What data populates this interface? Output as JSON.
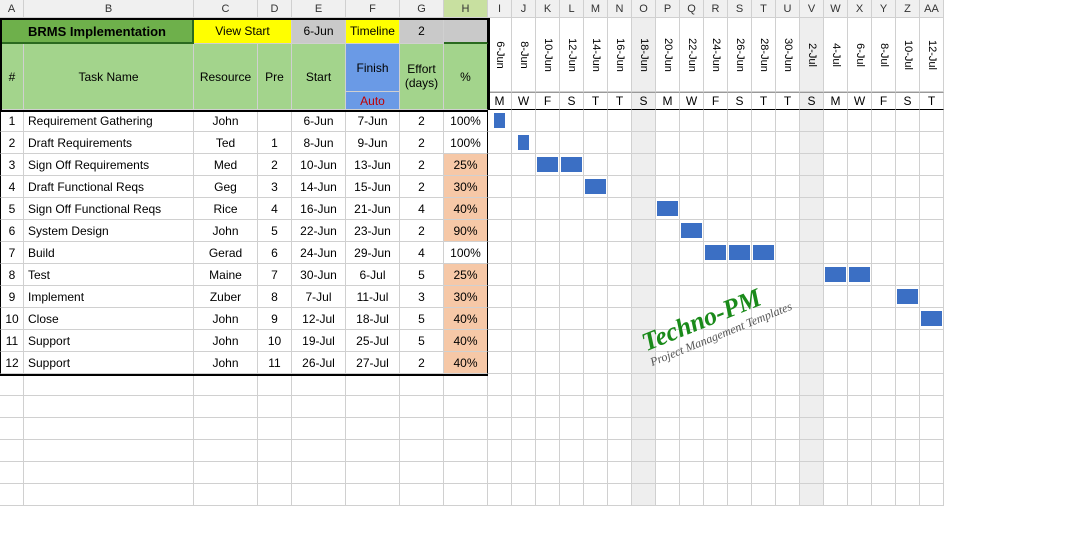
{
  "col_letters": [
    "A",
    "B",
    "C",
    "D",
    "E",
    "F",
    "G",
    "H",
    "I",
    "J",
    "K",
    "L",
    "M",
    "N",
    "O",
    "P",
    "Q",
    "R",
    "S",
    "T",
    "U",
    "V",
    "W",
    "X",
    "Y",
    "Z",
    "AA"
  ],
  "selected_col_idx": 7,
  "header": {
    "title": "BRMS Implementation",
    "view_start_label": "View Start",
    "view_start_val": "6-Jun",
    "timeline_label": "Timeline",
    "timeline_val": "2",
    "num_label": "#",
    "task_label": "Task Name",
    "resource_label": "Resource",
    "pre_label": "Pre",
    "start_label": "Start",
    "finish_label": "Finish",
    "auto_label": "Auto",
    "effort_label": "Effort (days)",
    "percent_label": "%"
  },
  "dates": [
    "6-Jun",
    "8-Jun",
    "10-Jun",
    "12-Jun",
    "14-Jun",
    "16-Jun",
    "18-Jun",
    "20-Jun",
    "22-Jun",
    "24-Jun",
    "26-Jun",
    "28-Jun",
    "30-Jun",
    "2-Jul",
    "4-Jul",
    "6-Jul",
    "8-Jul",
    "10-Jul",
    "12-Jul"
  ],
  "dows": [
    "M",
    "W",
    "F",
    "S",
    "T",
    "T",
    "S",
    "M",
    "W",
    "F",
    "S",
    "T",
    "T",
    "S",
    "M",
    "W",
    "F",
    "S",
    "T"
  ],
  "shaded_date_idx": [
    6,
    13
  ],
  "rows": [
    {
      "n": "1",
      "task": "Requirement Gathering",
      "res": "John",
      "pre": "",
      "start": "6-Jun",
      "finish": "7-Jun",
      "effort": "2",
      "pct": "100%",
      "peach": false,
      "bar_start": 0,
      "bar_len": 1,
      "partial": true
    },
    {
      "n": "2",
      "task": "Draft  Requirements",
      "res": "Ted",
      "pre": "1",
      "start": "8-Jun",
      "finish": "9-Jun",
      "effort": "2",
      "pct": "100%",
      "peach": false,
      "bar_start": 1,
      "bar_len": 1,
      "partial": true
    },
    {
      "n": "3",
      "task": "Sign Off  Requirements",
      "res": "Med",
      "pre": "2",
      "start": "10-Jun",
      "finish": "13-Jun",
      "effort": "2",
      "pct": "25%",
      "peach": true,
      "bar_start": 2,
      "bar_len": 2,
      "partial": false
    },
    {
      "n": "4",
      "task": "Draft Functional Reqs",
      "res": "Geg",
      "pre": "3",
      "start": "14-Jun",
      "finish": "15-Jun",
      "effort": "2",
      "pct": "30%",
      "peach": true,
      "bar_start": 4,
      "bar_len": 1,
      "partial": false
    },
    {
      "n": "5",
      "task": "Sign Off Functional Reqs",
      "res": "Rice",
      "pre": "4",
      "start": "16-Jun",
      "finish": "21-Jun",
      "effort": "4",
      "pct": "40%",
      "peach": true,
      "bar_start": 7,
      "bar_len": 1,
      "partial": false
    },
    {
      "n": "6",
      "task": "System Design",
      "res": "John",
      "pre": "5",
      "start": "22-Jun",
      "finish": "23-Jun",
      "effort": "2",
      "pct": "90%",
      "peach": true,
      "bar_start": 8,
      "bar_len": 1,
      "partial": false
    },
    {
      "n": "7",
      "task": "Build",
      "res": "Gerad",
      "pre": "6",
      "start": "24-Jun",
      "finish": "29-Jun",
      "effort": "4",
      "pct": "100%",
      "peach": false,
      "bar_start": 9,
      "bar_len": 3,
      "partial": false
    },
    {
      "n": "8",
      "task": "Test",
      "res": "Maine",
      "pre": "7",
      "start": "30-Jun",
      "finish": "6-Jul",
      "effort": "5",
      "pct": "25%",
      "peach": true,
      "bar_start": 14,
      "bar_len": 2,
      "partial": false
    },
    {
      "n": "9",
      "task": "Implement",
      "res": "Zuber",
      "pre": "8",
      "start": "7-Jul",
      "finish": "11-Jul",
      "effort": "3",
      "pct": "30%",
      "peach": true,
      "bar_start": 17,
      "bar_len": 1,
      "partial": false
    },
    {
      "n": "10",
      "task": "Close",
      "res": "John",
      "pre": "9",
      "start": "12-Jul",
      "finish": "18-Jul",
      "effort": "5",
      "pct": "40%",
      "peach": true,
      "bar_start": 18,
      "bar_len": 1,
      "partial": false
    },
    {
      "n": "11",
      "task": "Support",
      "res": "John",
      "pre": "10",
      "start": "19-Jul",
      "finish": "25-Jul",
      "effort": "5",
      "pct": "40%",
      "peach": true,
      "bar_start": -1,
      "bar_len": 0,
      "partial": false
    },
    {
      "n": "12",
      "task": "Support",
      "res": "John",
      "pre": "11",
      "start": "26-Jul",
      "finish": "27-Jul",
      "effort": "2",
      "pct": "40%",
      "peach": true,
      "bar_start": -1,
      "bar_len": 0,
      "partial": false
    }
  ],
  "empty_rows": 6,
  "watermark": {
    "line1": "Techno-PM",
    "line2": "Project Management Templates"
  },
  "chart_data": {
    "type": "gantt",
    "title": "BRMS Implementation",
    "timeline_step_days": 2,
    "x_dates": [
      "6-Jun",
      "8-Jun",
      "10-Jun",
      "12-Jun",
      "14-Jun",
      "16-Jun",
      "18-Jun",
      "20-Jun",
      "22-Jun",
      "24-Jun",
      "26-Jun",
      "28-Jun",
      "30-Jun",
      "2-Jul",
      "4-Jul",
      "6-Jul",
      "8-Jul",
      "10-Jul",
      "12-Jul"
    ],
    "tasks": [
      {
        "id": 1,
        "name": "Requirement Gathering",
        "resource": "John",
        "predecessor": null,
        "start": "6-Jun",
        "finish": "7-Jun",
        "effort_days": 2,
        "percent_complete": 100
      },
      {
        "id": 2,
        "name": "Draft Requirements",
        "resource": "Ted",
        "predecessor": 1,
        "start": "8-Jun",
        "finish": "9-Jun",
        "effort_days": 2,
        "percent_complete": 100
      },
      {
        "id": 3,
        "name": "Sign Off Requirements",
        "resource": "Med",
        "predecessor": 2,
        "start": "10-Jun",
        "finish": "13-Jun",
        "effort_days": 2,
        "percent_complete": 25
      },
      {
        "id": 4,
        "name": "Draft Functional Reqs",
        "resource": "Geg",
        "predecessor": 3,
        "start": "14-Jun",
        "finish": "15-Jun",
        "effort_days": 2,
        "percent_complete": 30
      },
      {
        "id": 5,
        "name": "Sign Off Functional Reqs",
        "resource": "Rice",
        "predecessor": 4,
        "start": "16-Jun",
        "finish": "21-Jun",
        "effort_days": 4,
        "percent_complete": 40
      },
      {
        "id": 6,
        "name": "System Design",
        "resource": "John",
        "predecessor": 5,
        "start": "22-Jun",
        "finish": "23-Jun",
        "effort_days": 2,
        "percent_complete": 90
      },
      {
        "id": 7,
        "name": "Build",
        "resource": "Gerad",
        "predecessor": 6,
        "start": "24-Jun",
        "finish": "29-Jun",
        "effort_days": 4,
        "percent_complete": 100
      },
      {
        "id": 8,
        "name": "Test",
        "resource": "Maine",
        "predecessor": 7,
        "start": "30-Jun",
        "finish": "6-Jul",
        "effort_days": 5,
        "percent_complete": 25
      },
      {
        "id": 9,
        "name": "Implement",
        "resource": "Zuber",
        "predecessor": 8,
        "start": "7-Jul",
        "finish": "11-Jul",
        "effort_days": 3,
        "percent_complete": 30
      },
      {
        "id": 10,
        "name": "Close",
        "resource": "John",
        "predecessor": 9,
        "start": "12-Jul",
        "finish": "18-Jul",
        "effort_days": 5,
        "percent_complete": 40
      },
      {
        "id": 11,
        "name": "Support",
        "resource": "John",
        "predecessor": 10,
        "start": "19-Jul",
        "finish": "25-Jul",
        "effort_days": 5,
        "percent_complete": 40
      },
      {
        "id": 12,
        "name": "Support",
        "resource": "John",
        "predecessor": 11,
        "start": "26-Jul",
        "finish": "27-Jul",
        "effort_days": 2,
        "percent_complete": 40
      }
    ]
  }
}
